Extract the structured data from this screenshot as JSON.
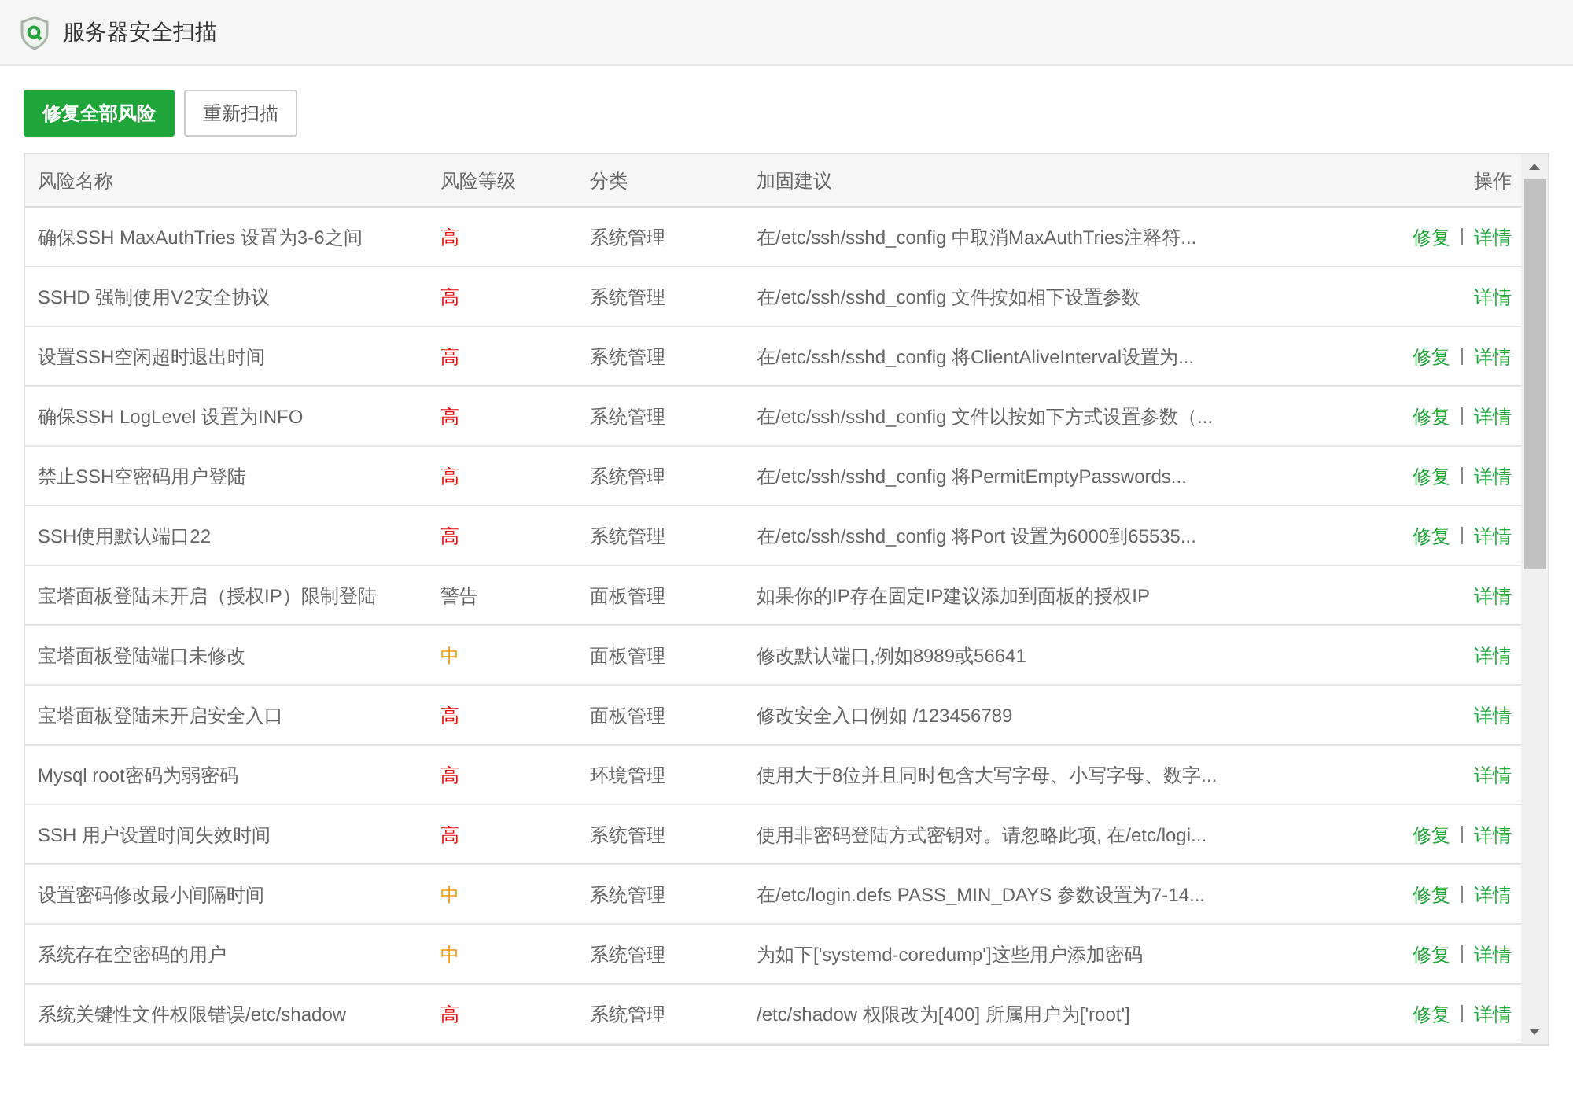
{
  "window": {
    "title": "服务器安全扫描"
  },
  "toolbar": {
    "buttons": [
      {
        "label": "修复全部风险",
        "kind": "primary"
      },
      {
        "label": "重新扫描",
        "kind": "default"
      }
    ]
  },
  "table": {
    "columns": [
      "风险名称",
      "风险等级",
      "分类",
      "加固建议",
      "操作"
    ],
    "rows": [
      {
        "name": "确保SSH MaxAuthTries 设置为3-6之间",
        "risk": "高",
        "kind": "high",
        "category": "系统管理",
        "suggestion": "在/etc/ssh/sshd_config 中取消MaxAuthTries注释符...",
        "actions": [
          "修复",
          "详情"
        ]
      },
      {
        "name": "SSHD 强制使用V2安全协议",
        "risk": "高",
        "kind": "high",
        "category": "系统管理",
        "suggestion": "在/etc/ssh/sshd_config 文件按如相下设置参数",
        "actions": [
          "详情"
        ]
      },
      {
        "name": "设置SSH空闲超时退出时间",
        "risk": "高",
        "kind": "high",
        "category": "系统管理",
        "suggestion": "在/etc/ssh/sshd_config 将ClientAliveInterval设置为...",
        "actions": [
          "修复",
          "详情"
        ]
      },
      {
        "name": "确保SSH LogLevel 设置为INFO",
        "risk": "高",
        "kind": "high",
        "category": "系统管理",
        "suggestion": "在/etc/ssh/sshd_config 文件以按如下方式设置参数（...",
        "actions": [
          "修复",
          "详情"
        ]
      },
      {
        "name": "禁止SSH空密码用户登陆",
        "risk": "高",
        "kind": "high",
        "category": "系统管理",
        "suggestion": "在/etc/ssh/sshd_config 将PermitEmptyPasswords...",
        "actions": [
          "修复",
          "详情"
        ]
      },
      {
        "name": "SSH使用默认端口22",
        "risk": "高",
        "kind": "high",
        "category": "系统管理",
        "suggestion": "在/etc/ssh/sshd_config 将Port 设置为6000到65535...",
        "actions": [
          "修复",
          "详情"
        ]
      },
      {
        "name": "宝塔面板登陆未开启（授权IP）限制登陆",
        "risk": "警告",
        "kind": "warning",
        "category": "面板管理",
        "suggestion": "如果你的IP存在固定IP建议添加到面板的授权IP",
        "actions": [
          "详情"
        ]
      },
      {
        "name": "宝塔面板登陆端口未修改",
        "risk": "中",
        "kind": "medium",
        "category": "面板管理",
        "suggestion": "修改默认端口,例如8989或56641",
        "actions": [
          "详情"
        ]
      },
      {
        "name": "宝塔面板登陆未开启安全入口",
        "risk": "高",
        "kind": "high",
        "category": "面板管理",
        "suggestion": "修改安全入口例如 /123456789",
        "actions": [
          "详情"
        ]
      },
      {
        "name": "Mysql root密码为弱密码",
        "risk": "高",
        "kind": "high",
        "category": "环境管理",
        "suggestion": "使用大于8位并且同时包含大写字母、小写字母、数字...",
        "actions": [
          "详情"
        ]
      },
      {
        "name": "SSH 用户设置时间失效时间",
        "risk": "高",
        "kind": "high",
        "category": "系统管理",
        "suggestion": "使用非密码登陆方式密钥对。请忽略此项, 在/etc/logi...",
        "actions": [
          "修复",
          "详情"
        ]
      },
      {
        "name": "设置密码修改最小间隔时间",
        "risk": "中",
        "kind": "medium",
        "category": "系统管理",
        "suggestion": "在/etc/login.defs PASS_MIN_DAYS 参数设置为7-14...",
        "actions": [
          "修复",
          "详情"
        ]
      },
      {
        "name": "系统存在空密码的用户",
        "risk": "中",
        "kind": "medium",
        "category": "系统管理",
        "suggestion": "为如下['systemd-coredump']这些用户添加密码",
        "actions": [
          "修复",
          "详情"
        ]
      },
      {
        "name": "系统关键性文件权限错误/etc/shadow",
        "risk": "高",
        "kind": "high",
        "category": "系统管理",
        "suggestion": "/etc/shadow 权限改为[400] 所属用户为['root']",
        "actions": [
          "修复",
          "详情"
        ]
      }
    ]
  }
}
